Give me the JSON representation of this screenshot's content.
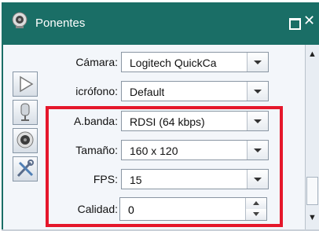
{
  "window": {
    "title": "Ponentes"
  },
  "fields": {
    "camera_label": "Cámara:",
    "camera_value": "Logitech QuickCa",
    "mic_label": "icrófono:",
    "mic_value": "Default",
    "bandwidth_label": "A.banda:",
    "bandwidth_value": "RDSI (64 kbps)",
    "size_label": "Tamaño:",
    "size_value": "160 x 120",
    "fps_label": "FPS:",
    "fps_value": "15",
    "quality_label": "Calidad:",
    "quality_value": "0"
  },
  "icons": {
    "title": "webcam-icon",
    "play": "play-icon",
    "mic": "microphone-icon",
    "camera": "webcam-icon",
    "settings": "tools-icon"
  },
  "colors": {
    "titlebar": "#1a6e66",
    "highlight": "#e5172b"
  }
}
